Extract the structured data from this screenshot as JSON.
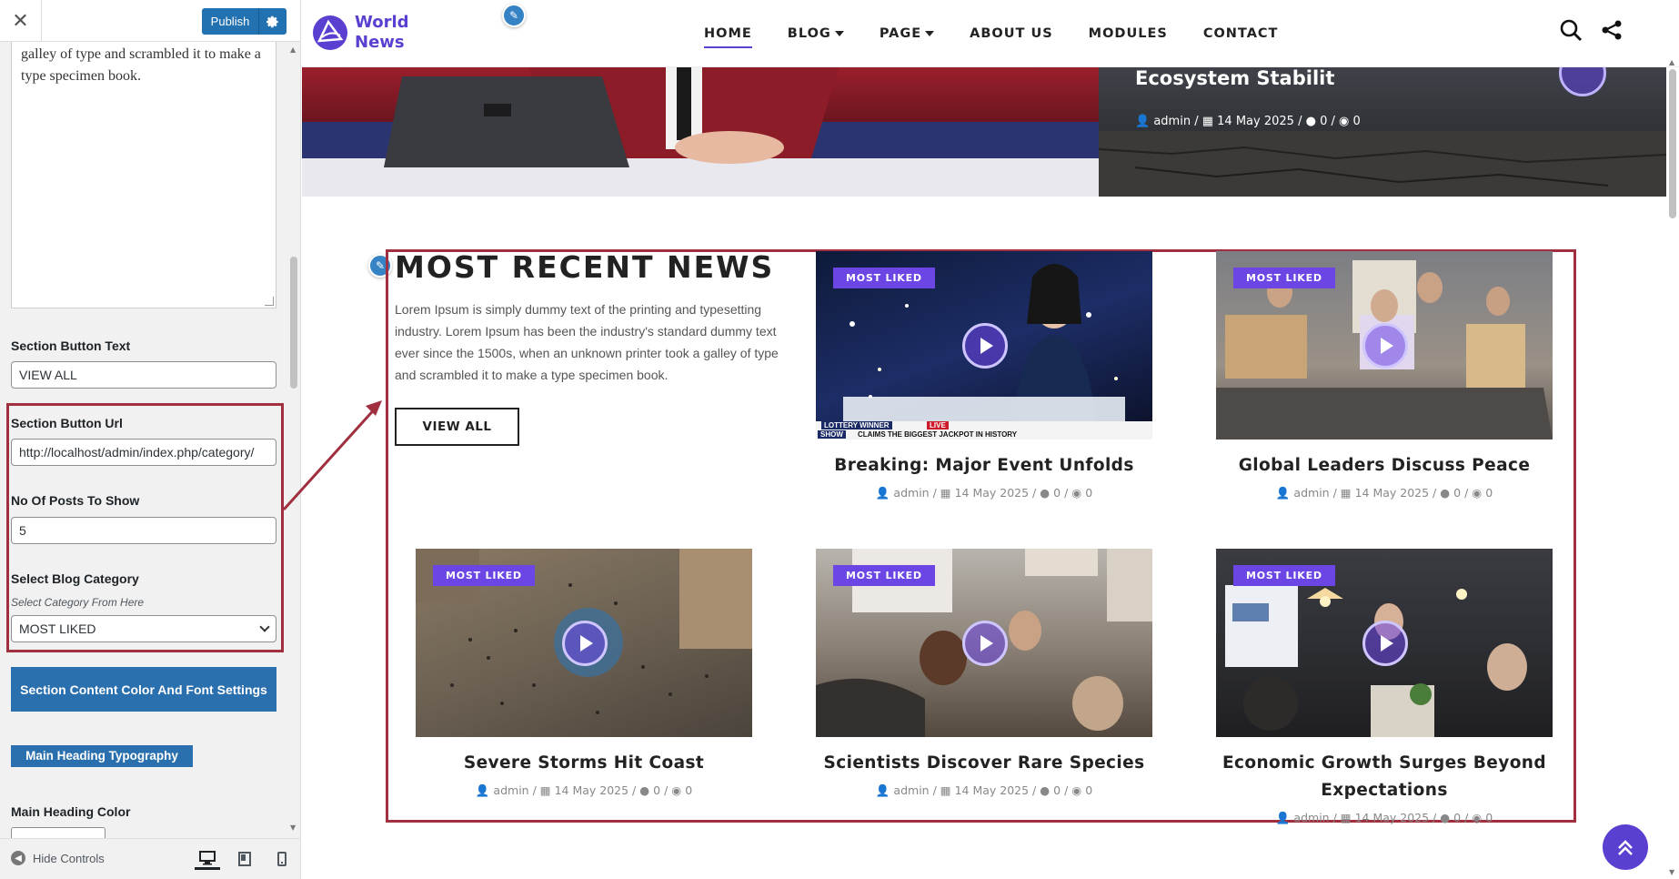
{
  "customizer": {
    "close_glyph": "✕",
    "publish_label": "Publish",
    "textarea_text": "galley of type and scrambled it to make a type specimen book.",
    "section_button_text": {
      "label": "Section Button Text",
      "value": "VIEW ALL"
    },
    "section_button_url": {
      "label": "Section Button Url",
      "value": "http://localhost/admin/index.php/category/"
    },
    "posts_to_show": {
      "label": "No Of Posts To Show",
      "value": "5"
    },
    "blog_category": {
      "label": "Select Blog Category",
      "description": "Select Category From Here",
      "selected": "MOST LIKED"
    },
    "content_settings_button": "Section Content Color And Font Settings",
    "main_heading_typography_button": "Main Heading Typography",
    "main_heading_color_label": "Main Heading Color",
    "hide_controls_label": "Hide Controls",
    "accent_color": "#2271b1",
    "highlight_color": "#a0303f"
  },
  "site": {
    "logo_line1": "World",
    "logo_line2": "News",
    "brand_color": "#5b3fd1",
    "menu": [
      "HOME",
      "BLOG",
      "PAGE",
      "ABOUT US",
      "MODULES",
      "CONTACT"
    ],
    "hero_right": {
      "title": "Ecosystem Stabilit",
      "author": "admin",
      "date": "14 May 2025",
      "comments": "0",
      "views": "0"
    }
  },
  "section": {
    "title": "MOST RECENT NEWS",
    "description": "Lorem Ipsum is simply dummy text of the printing and typesetting industry. Lorem Ipsum has been the industry's standard dummy text ever since the 1500s, when an unknown printer took a galley of type and scrambled it to make a type specimen book.",
    "button": "VIEW ALL",
    "posts": [
      {
        "badge": "MOST LIKED",
        "title": "Breaking: Major Event Unfolds",
        "author": "admin",
        "date": "14 May 2025",
        "comments": "0",
        "views": "0",
        "ticker_top": "LOTTERY WINNER",
        "ticker_live": "LIVE",
        "ticker_show": "SHOW",
        "ticker_text": "CLAIMS THE BIGGEST JACKPOT IN HISTORY"
      },
      {
        "badge": "MOST LIKED",
        "title": "Global Leaders Discuss Peace",
        "author": "admin",
        "date": "14 May 2025",
        "comments": "0",
        "views": "0"
      },
      {
        "badge": "MOST LIKED",
        "title": "Severe Storms Hit Coast",
        "author": "admin",
        "date": "14 May 2025",
        "comments": "0",
        "views": "0"
      },
      {
        "badge": "MOST LIKED",
        "title": "Scientists Discover Rare Species",
        "author": "admin",
        "date": "14 May 2025",
        "comments": "0",
        "views": "0"
      },
      {
        "badge": "MOST LIKED",
        "title": "Economic Growth Surges Beyond Expectations",
        "author": "admin",
        "date": "14 May 2025",
        "comments": "0",
        "views": "0"
      }
    ]
  }
}
